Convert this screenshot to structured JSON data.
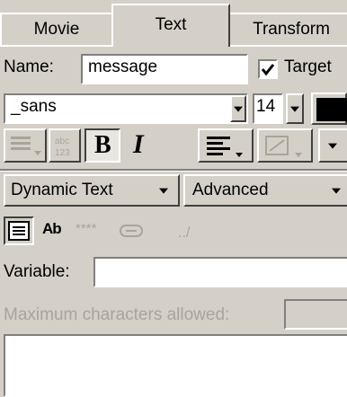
{
  "tabs": [
    {
      "label": "Movie"
    },
    {
      "label": "Text"
    },
    {
      "label": "Transform"
    }
  ],
  "name_field": {
    "label": "Name:",
    "value": "message"
  },
  "target_checkbox": {
    "label": "Target",
    "checked": true
  },
  "font": {
    "family": "_sans",
    "size": "14"
  },
  "format_buttons": {
    "bold": "B",
    "italic": "I"
  },
  "text_type": {
    "selected": "Dynamic Text"
  },
  "advanced": {
    "label": "Advanced"
  },
  "variable": {
    "label": "Variable:",
    "value": ""
  },
  "max_chars": {
    "label": "Maximum characters allowed:",
    "value": ""
  },
  "mini_icons": {
    "ab": "Ab",
    "stars": "****"
  },
  "colors": {
    "panel": "#d4d0c8",
    "color_swatch": "#000000"
  }
}
